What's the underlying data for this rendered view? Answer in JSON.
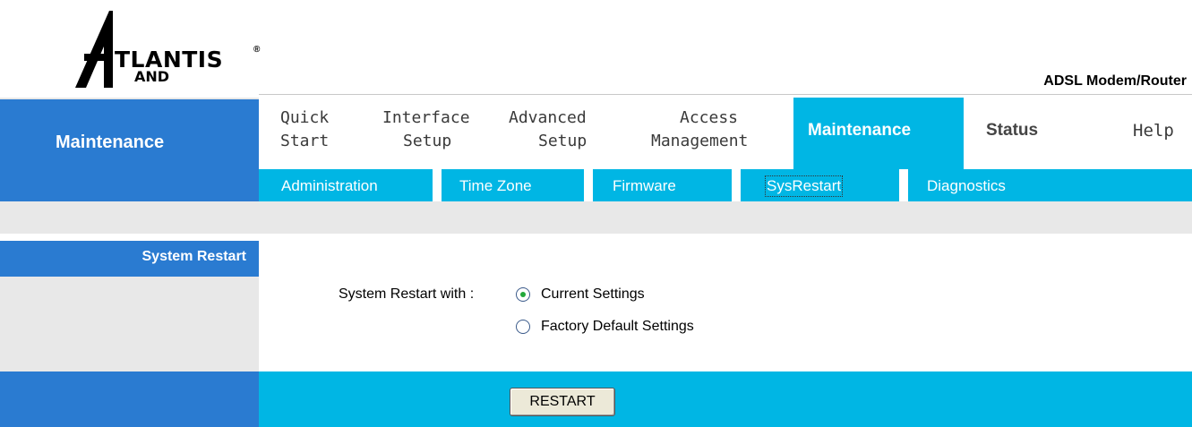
{
  "header": {
    "logo_text": "TLANTIS",
    "logo_reg": "®",
    "logo_and": "AND",
    "product": "ADSL Modem/Router"
  },
  "left": {
    "title": "Maintenance"
  },
  "nav": {
    "quick_start": [
      "Quick",
      "Start"
    ],
    "interface_setup": [
      "Interface",
      "Setup"
    ],
    "advanced_setup": [
      "Advanced",
      "Setup"
    ],
    "access_management": [
      "Access",
      "Management"
    ],
    "maintenance": "Maintenance",
    "status": "Status",
    "help": "Help"
  },
  "subnav": {
    "items": [
      "Administration",
      "Time Zone",
      "Firmware",
      "SysRestart",
      "Diagnostics"
    ],
    "active": "SysRestart"
  },
  "section": {
    "title": "System Restart",
    "label": "System Restart with :",
    "options": [
      "Current Settings",
      "Factory Default Settings"
    ],
    "selected": "Current Settings"
  },
  "footer": {
    "restart_label": "RESTART"
  },
  "colors": {
    "primary_blue": "#2a7bd1",
    "accent_cyan": "#00b6e4",
    "band_grey": "#e8e8e8"
  }
}
